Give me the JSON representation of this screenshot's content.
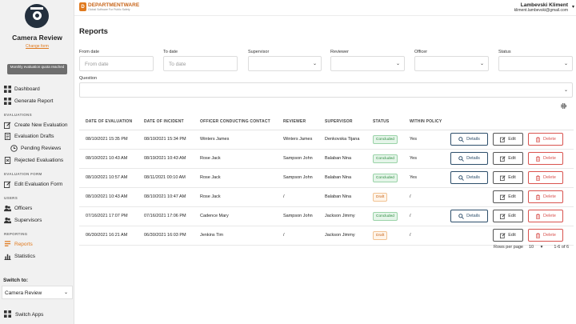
{
  "sidebar": {
    "app_title": "Camera Review",
    "change_form": "Change form",
    "quota_notice": "Monthly evaluation quota reached",
    "dashboard": "Dashboard",
    "generate_report": "Generate Report",
    "sections": {
      "evaluations": "EVALUATIONS",
      "evaluation_form": "EVALUATION FORM",
      "users": "USERS",
      "reporting": "REPORTING"
    },
    "create_new_evaluation": "Create New Evaluation",
    "evaluation_drafts": "Evaluation Drafts",
    "pending_reviews": "Pending Reviews",
    "rejected_evaluations": "Rejected Evaluations",
    "edit_evaluation_form": "Edit Evaluation Form",
    "officers": "Officers",
    "supervisors": "Supervisors",
    "reports": "Reports",
    "statistics": "Statistics",
    "switch_to": "Switch to:",
    "switch_value": "Camera Review",
    "switch_apps": "Switch Apps"
  },
  "header": {
    "brand_name": "DEPARTMENTWARE",
    "brand_tagline": "Global Software For Public Safety",
    "user_name": "Lambevski Kliment",
    "user_email": "kliment.lambevski@gmail.com"
  },
  "page": {
    "title": "Reports"
  },
  "filters": {
    "from_date_label": "From date",
    "from_date_placeholder": "From date",
    "to_date_label": "To date",
    "to_date_placeholder": "To date",
    "supervisor_label": "Supervisor",
    "reviewer_label": "Reviewer",
    "officer_label": "Officer",
    "status_label": "Status",
    "question_label": "Question"
  },
  "table": {
    "headers": [
      "DATE OF EVALUATION",
      "DATE OF INCIDENT",
      "OFFICER CONDUCTING CONTACT",
      "REVIEWER",
      "SUPERVISOR",
      "STATUS",
      "WITHIN POLICY"
    ],
    "buttons": {
      "details": "Details",
      "edit": "Edit",
      "delete": "Delete"
    },
    "rows": [
      {
        "eval_date": "08/10/2021 15:35 PM",
        "incident_date": "08/10/2021 15:34 PM",
        "officer": "Winters James",
        "reviewer": "Winters James",
        "supervisor": "Denkovska Tijana",
        "status": "Concluded",
        "within_policy": "Yes"
      },
      {
        "eval_date": "08/10/2021 10:43 AM",
        "incident_date": "08/19/2021 10:43 AM",
        "officer": "Rose Jack",
        "reviewer": "Sampson John",
        "supervisor": "Balaban Nina",
        "status": "Concluded",
        "within_policy": "Yes"
      },
      {
        "eval_date": "08/10/2021 10:57 AM",
        "incident_date": "08/11/2021 00:10 AM",
        "officer": "Rose Jack",
        "reviewer": "Sampson John",
        "supervisor": "Balaban Nina",
        "status": "Concluded",
        "within_policy": "Yes"
      },
      {
        "eval_date": "08/10/2021 10:43 AM",
        "incident_date": "08/10/2021 10:47 AM",
        "officer": "Rose Jack",
        "reviewer": "/",
        "supervisor": "Balaban Nina",
        "status": "Draft",
        "within_policy": "/"
      },
      {
        "eval_date": "07/16/2021 17:07 PM",
        "incident_date": "07/16/2021 17:06 PM",
        "officer": "Cadence Mary",
        "reviewer": "Sampson John",
        "supervisor": "Jackson Jimmy",
        "status": "Concluded",
        "within_policy": "/"
      },
      {
        "eval_date": "06/30/2021 16:21 AM",
        "incident_date": "06/30/2021 16:03 PM",
        "officer": "Jenkins Tim",
        "reviewer": "/",
        "supervisor": "Jackson Jimmy",
        "status": "Draft",
        "within_policy": "/"
      }
    ]
  },
  "pagination": {
    "rows_per_page_label": "Rows per page",
    "rows_per_page_value": "10",
    "range": "1-6 of 6"
  },
  "colors": {
    "accent": "#e07a1f",
    "details_border": "#2d4e6b",
    "delete_red": "#d9534f",
    "concluded_green": "#2b8a3e"
  }
}
